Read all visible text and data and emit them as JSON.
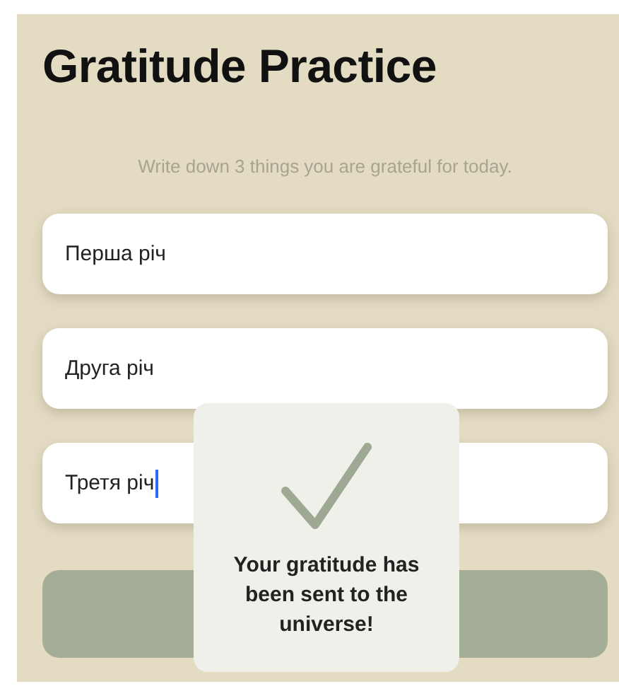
{
  "title": "Gratitude Practice",
  "subtitle": "Write down 3 things you are grateful for today.",
  "fields": [
    {
      "value": "Перша річ",
      "focused": false
    },
    {
      "value": "Друга річ",
      "focused": false
    },
    {
      "value": "Третя річ",
      "focused": true
    }
  ],
  "toast": {
    "message": "Your gratitude has been sent to the universe!"
  }
}
